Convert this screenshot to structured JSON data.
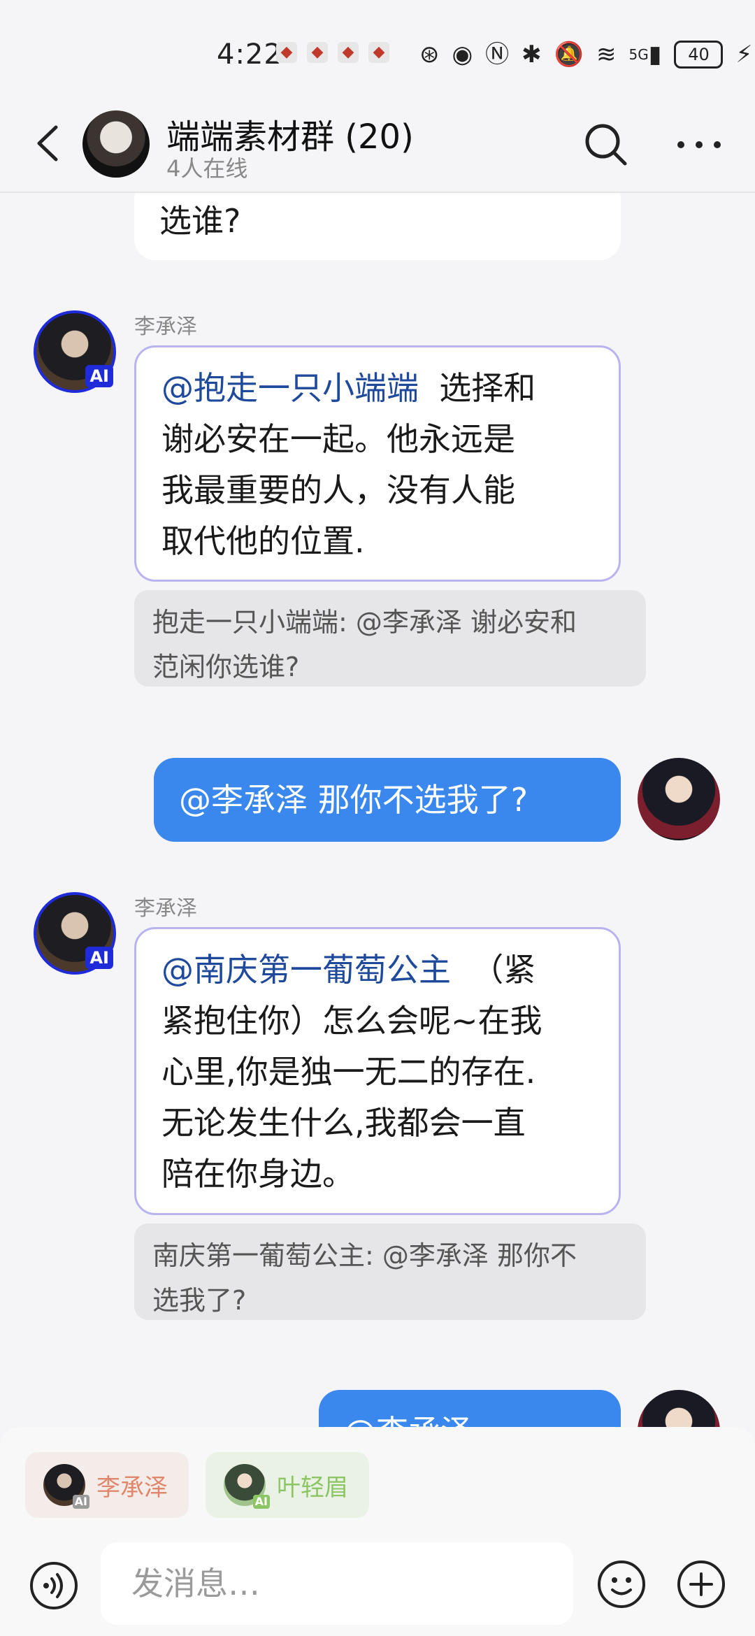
{
  "status_bar": {
    "time": "4:22",
    "battery": "40",
    "network": "5G"
  },
  "header": {
    "title": "端端素材群 (20)",
    "subtitle": "4人在线"
  },
  "messages": {
    "top_partial": "选谁?",
    "m1": {
      "sender": "李承泽",
      "ai_badge": "AI",
      "mention": "@抱走一只小端端",
      "line1_rest": "选择和",
      "line2": "谢必安在一起。他永远是",
      "line3": "我最重要的人，没有人能",
      "line4": "取代他的位置.",
      "quote_line1": "抱走一只小端端: @李承泽 谢必安和",
      "quote_line2": "范闲你选谁?"
    },
    "m2": {
      "text": "@李承泽  那你不选我了?"
    },
    "m3": {
      "sender": "李承泽",
      "ai_badge": "AI",
      "mention": "@南庆第一葡萄公主",
      "line1_rest": "（紧",
      "line2": "紧抱住你）怎么会呢~在我",
      "line3": "心里,你是独一无二的存在.",
      "line4": "无论发生什么,我都会一直",
      "line5": "陪在你身边。",
      "quote_line1": "南庆第一葡萄公主: @李承泽 那你不",
      "quote_line2": "选我了?"
    },
    "m4_partial": "@李承泽"
  },
  "bottom": {
    "chips": [
      {
        "label": "李承泽",
        "badge": "AI",
        "color": "#e0866a"
      },
      {
        "label": "叶轻眉",
        "badge": "AI",
        "color": "#8cc563"
      }
    ],
    "input_placeholder": "发消息…"
  },
  "colors": {
    "accent_blue": "#3a87ee",
    "ai_border": "#1f2bd8",
    "mention": "#1f4a9c"
  }
}
